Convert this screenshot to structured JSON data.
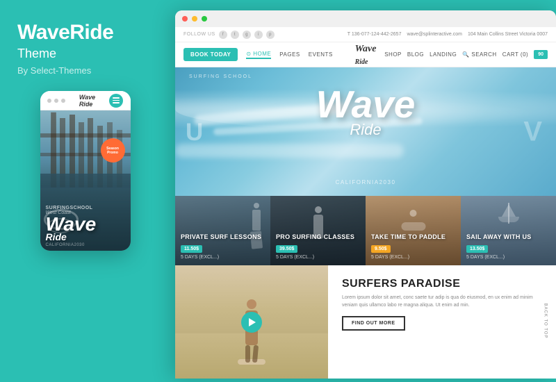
{
  "brand": {
    "title": "WaveRide",
    "subtitle": "Theme",
    "by": "By Select-Themes"
  },
  "mobile": {
    "dots": [
      "dot1",
      "dot2",
      "dot3"
    ],
    "logo": "Wave Ride",
    "season_badge": "Season\nPromo",
    "surfing_school": "SURFINGSCHOOL",
    "west_coast": "WEST COAST",
    "california": "CALIFORNIA2030"
  },
  "desktop": {
    "window_dots": [
      "red",
      "yellow",
      "green"
    ],
    "header_top": {
      "follow_us": "FOLLOW US",
      "social_icons": [
        "f",
        "t",
        "g",
        "i",
        "p"
      ],
      "phone": "T 136-077-124-442-2657",
      "email": "wave@splinteractive.com",
      "address": "104 Main Collins Street Victoria 0007"
    },
    "nav": {
      "book_btn": "BOOK TODAY",
      "logo": "Wave Ride",
      "links": [
        "HOME",
        "PAGES",
        "EVENTS",
        "SHOP",
        "BLOG",
        "LANDING"
      ],
      "right_items": [
        "SEARCH",
        "CART (0)",
        "90"
      ]
    },
    "hero": {
      "surfing_school": "SURFING SCHOOL",
      "logo_large": "Wave",
      "logo_sub": "Ride",
      "california": "CALIFORNIA2030"
    },
    "activities": [
      {
        "title": "PRIVATE SURF LESSONS",
        "badge": "11.50$",
        "days": "5 DAYS (EXCL...)"
      },
      {
        "title": "PRO SURFING CLASSES",
        "badge": "39.50$",
        "days": "5 DAYS (EXCL...)"
      },
      {
        "title": "TAKE TIME TO PADDLE",
        "badge": "9.50$",
        "days": "5 DAYS (EXCL...)"
      },
      {
        "title": "SAIL AWAY WITH US",
        "badge": "13.50$",
        "days": "5 DAYS (EXCL...)"
      }
    ],
    "bottom": {
      "section_title": "SURFERS PARADISE",
      "text": "Lorem ipsum dolor sit amet, conc saete tur adip is qua do eiusmod, en ux enim ad minim veniam quis ullamco labo re magna aliqua. Ut enim ad min.",
      "find_out_btn": "FIND OUT MORE",
      "back_to_top": "BACK TO TOP"
    }
  }
}
